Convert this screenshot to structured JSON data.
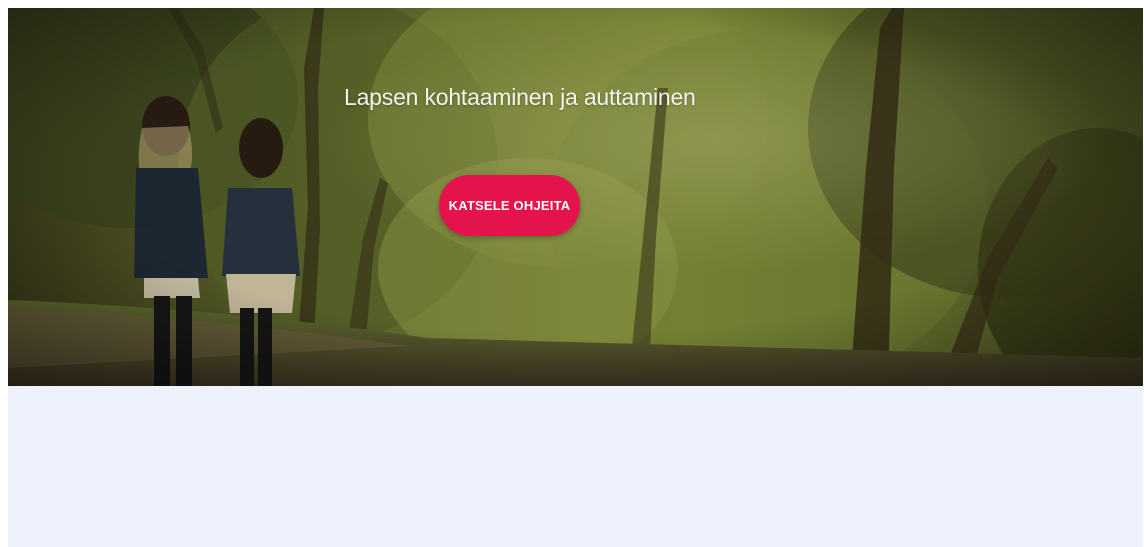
{
  "hero": {
    "title": "Lapsen kohtaaminen ja auttaminen",
    "cta_label": "KATSELE OHJEITA",
    "image": "two-children-walking-in-forest"
  },
  "colors": {
    "cta_background": "#e4134b",
    "lower_section_background": "#edf2fd"
  }
}
